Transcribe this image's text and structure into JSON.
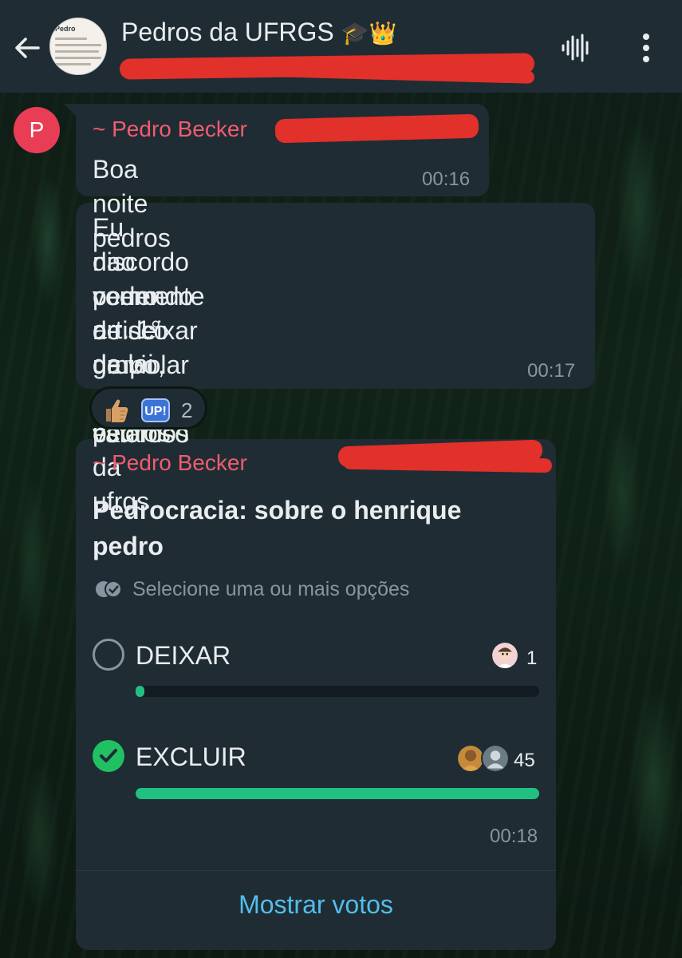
{
  "header": {
    "title": "Pedros da UFRGS",
    "title_emoji": "🎓👑",
    "avatar_doc_title": "Pedro"
  },
  "messages": [
    {
      "sender_initial": "P",
      "sender_name": "~ Pedro Becker",
      "text": "Boa noite pedros",
      "time": "00:16"
    },
    {
      "text_lines": [
        "Eu discordo veemente de deixar um",
        "nao pedro no grupo, pois estamos",
        "correndo o risco de violar o valoroso",
        "art. 1° da lei dos pedros da ufrgs"
      ],
      "time": "00:17",
      "reactions": {
        "up_label": "UP!",
        "count": "2"
      }
    }
  ],
  "poll": {
    "sender_name": "~ Pedro Becker",
    "question_lines": [
      "Pedrocracia: sobre o henrique",
      "pedro"
    ],
    "hint": "Selecione uma ou mais opções",
    "options": [
      {
        "label": "DEIXAR",
        "votes": "1",
        "selected": false,
        "fraction": 0.022
      },
      {
        "label": "EXCLUIR",
        "votes": "45",
        "selected": true,
        "fraction": 1.0
      }
    ],
    "time": "00:18",
    "show_votes_label": "Mostrar votos"
  },
  "colors": {
    "accent_green": "#21c063",
    "link_blue": "#53bdeb",
    "sender_pink": "#f15c6d",
    "bubble": "#1f2c34"
  }
}
